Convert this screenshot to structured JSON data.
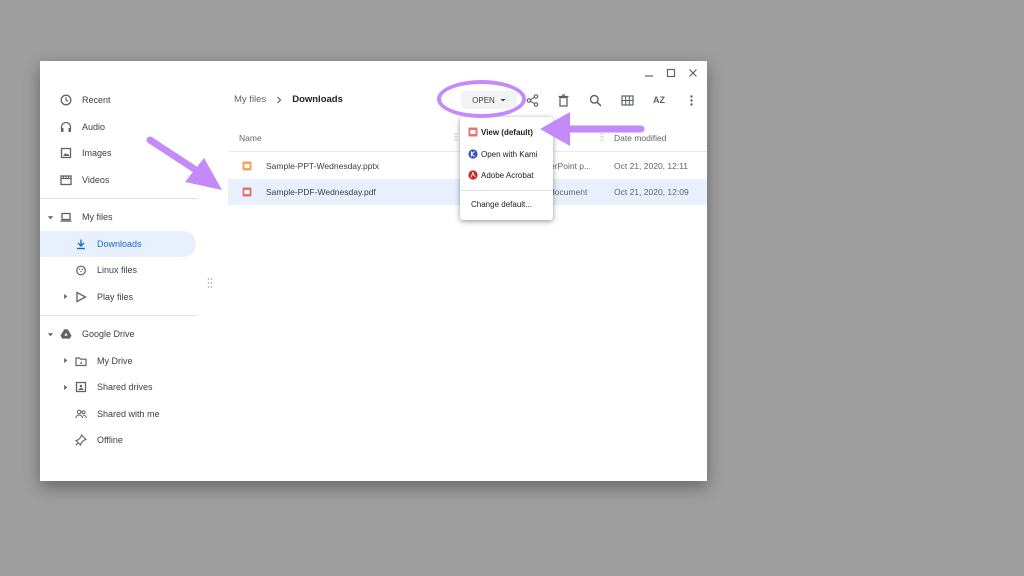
{
  "window": {
    "controls": [
      "minimize",
      "maximize",
      "close"
    ]
  },
  "sidebar": {
    "top_items": [
      {
        "label": "Recent",
        "icon": "clock-icon"
      },
      {
        "label": "Audio",
        "icon": "headphones-icon"
      },
      {
        "label": "Images",
        "icon": "image-icon"
      },
      {
        "label": "Videos",
        "icon": "video-icon"
      }
    ],
    "my_files": {
      "label": "My files",
      "icon": "laptop-icon"
    },
    "my_files_children": [
      {
        "label": "Downloads",
        "icon": "download-icon",
        "active": true
      },
      {
        "label": "Linux files",
        "icon": "penguin-icon"
      },
      {
        "label": "Play files",
        "icon": "play-icon"
      }
    ],
    "google_drive": {
      "label": "Google Drive",
      "icon": "drive-icon"
    },
    "drive_children": [
      {
        "label": "My Drive",
        "icon": "folder-drive-icon"
      },
      {
        "label": "Shared drives",
        "icon": "shared-drive-icon"
      },
      {
        "label": "Shared with me",
        "icon": "people-icon"
      },
      {
        "label": "Offline",
        "icon": "pin-icon"
      }
    ]
  },
  "breadcrumb": {
    "root": "My files",
    "current": "Downloads"
  },
  "toolbar": {
    "open_label": "OPEN",
    "icons": [
      "share-icon",
      "delete-icon",
      "search-icon",
      "grid-view-icon",
      "sort-az-icon",
      "more-vert-icon"
    ],
    "sort_label": "AZ"
  },
  "list": {
    "columns": {
      "name": "Name",
      "date": "Date modified"
    },
    "rows": [
      {
        "name": "Sample-PPT-Wednesday.pptx",
        "type": "erPoint p...",
        "date": "Oct 21, 2020, 12:11",
        "icon": "slides-file-icon"
      },
      {
        "name": "Sample-PDF-Wednesday.pdf",
        "type": "document",
        "date": "Oct 21, 2020, 12:09",
        "icon": "pdf-file-icon",
        "selected": true
      }
    ]
  },
  "open_menu": {
    "items": [
      {
        "label": "View (default)",
        "icon": "pdf-view-icon"
      },
      {
        "label": "Open with Kami",
        "icon": "kami-icon"
      },
      {
        "label": "Adobe Acrobat",
        "icon": "acrobat-icon"
      }
    ],
    "change_default": "Change default..."
  },
  "colors": {
    "annotation": "#c58af9",
    "selection": "#e8f0fe",
    "accent": "#1967d2",
    "backdrop": "#9e9e9e"
  }
}
